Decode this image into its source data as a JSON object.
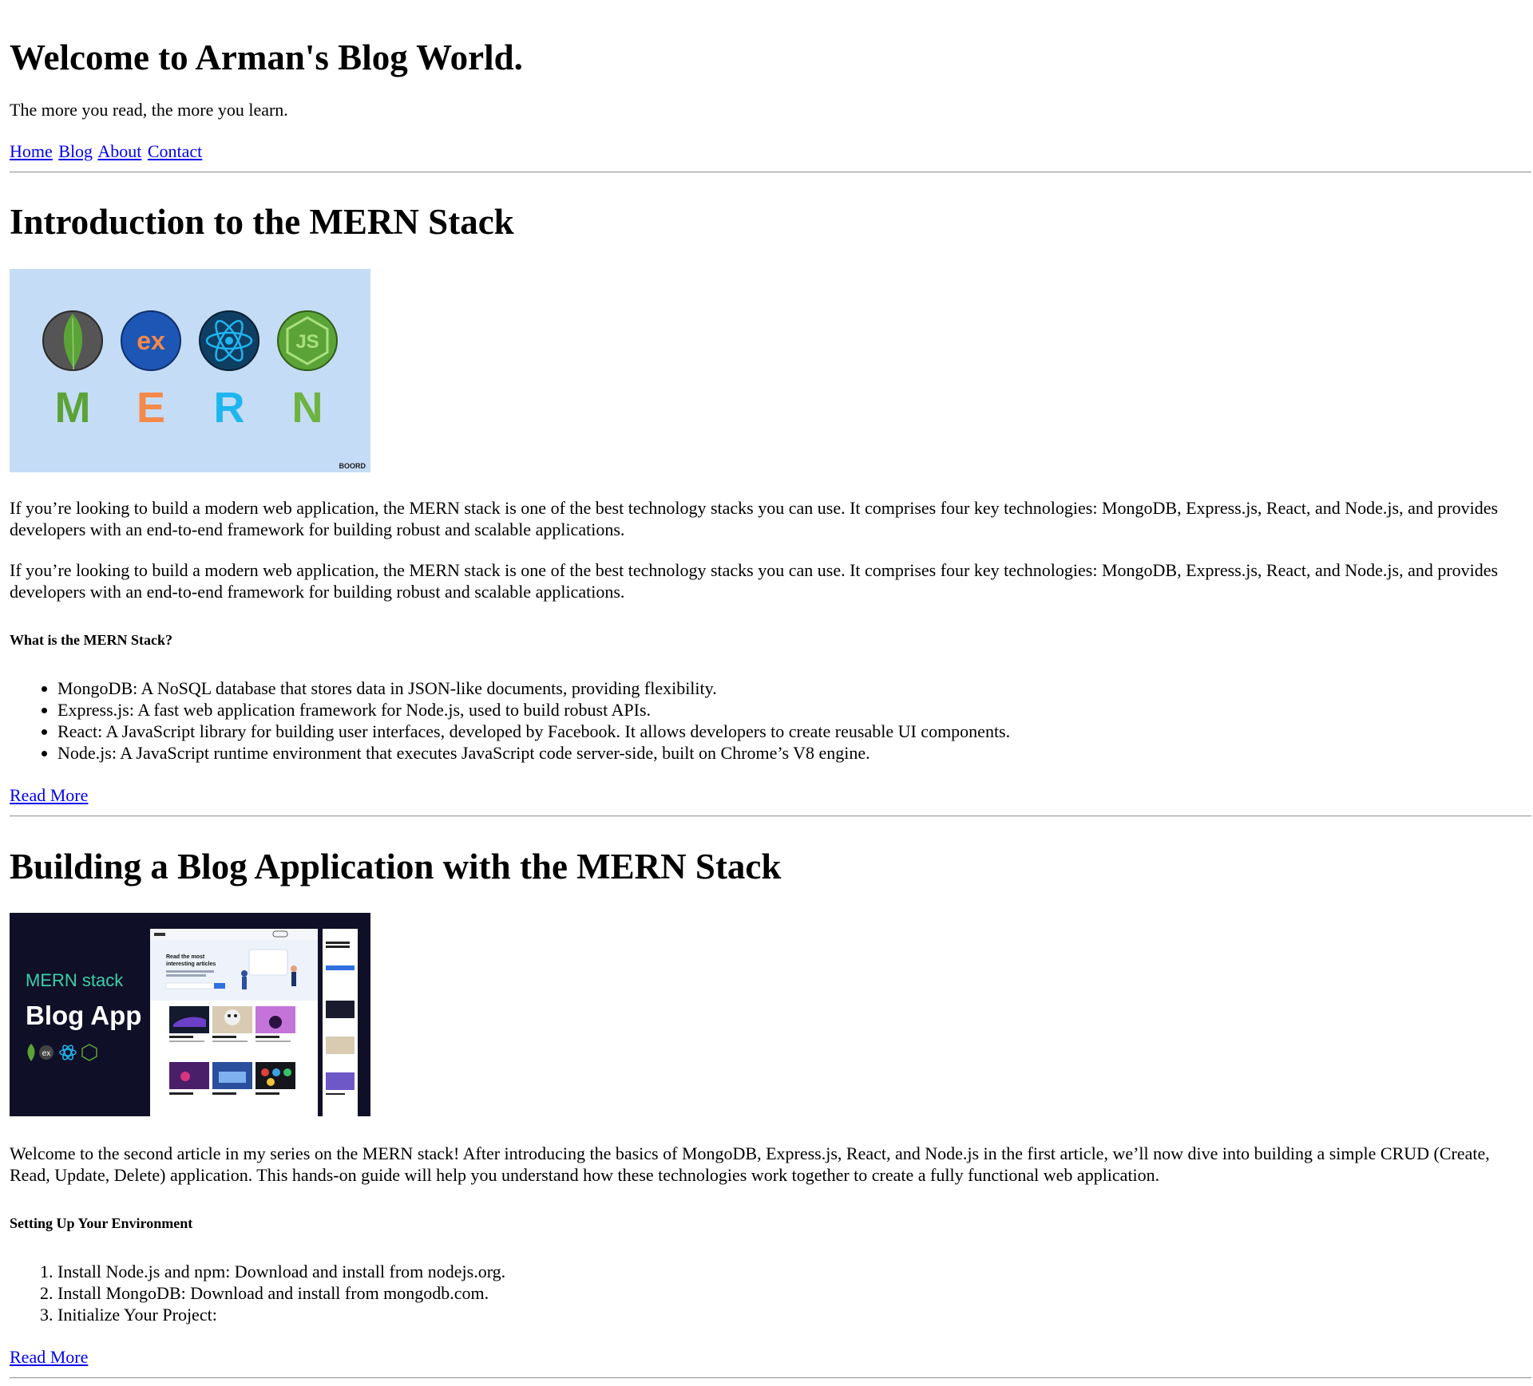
{
  "header": {
    "title": "Welcome to Arman's Blog World.",
    "tagline": "The more you read, the more you learn."
  },
  "nav": {
    "items": [
      {
        "label": "Home"
      },
      {
        "label": "Blog"
      },
      {
        "label": "About"
      },
      {
        "label": "Contact"
      }
    ]
  },
  "posts": [
    {
      "title": "Introduction to the MERN Stack",
      "image": {
        "icons": [
          "mongodb-icon",
          "express-icon",
          "react-icon",
          "nodejs-icon"
        ],
        "letters": [
          "M",
          "E",
          "R",
          "N"
        ],
        "icon_texts": [
          "ex",
          "JS"
        ],
        "watermark": "BOORD",
        "colors": {
          "background": "#c5dcf6",
          "m": "#5ba337",
          "e": "#f5894a",
          "r": "#1fb6f0",
          "n": "#6cb33f"
        }
      },
      "paragraphs": [
        "If you’re looking to build a modern web application, the MERN stack is one of the best technology stacks you can use. It comprises four key technologies: MongoDB, Express.js, React, and Node.js, and provides developers with an end-to-end framework for building robust and scalable applications.",
        "If you’re looking to build a modern web application, the MERN stack is one of the best technology stacks you can use. It comprises four key technologies: MongoDB, Express.js, React, and Node.js, and provides developers with an end-to-end framework for building robust and scalable applications."
      ],
      "subheading": "What is the MERN Stack?",
      "list": [
        "MongoDB: A NoSQL database that stores data in JSON-like documents, providing flexibility.",
        "Express.js: A fast web application framework for Node.js, used to build robust APIs.",
        "React: A JavaScript library for building user interfaces, developed by Facebook. It allows developers to create reusable UI components.",
        "Node.js: A JavaScript runtime environment that executes JavaScript code server-side, built on Chrome’s V8 engine."
      ],
      "read_more": "Read More"
    },
    {
      "title": "Building a Blog Application with the MERN Stack",
      "image": {
        "line1": "MERN stack",
        "line2": "Blog App",
        "mockup_heading": "Read the most interesting articles",
        "colors": {
          "background": "#0f0f27",
          "accent": "#3ecfa8"
        }
      },
      "paragraphs": [
        "Welcome to the second article in my series on the MERN stack! After introducing the basics of MongoDB, Express.js, React, and Node.js in the first article, we’ll now dive into building a simple CRUD (Create, Read, Update, Delete) application. This hands-on guide will help you understand how these technologies work together to create a fully functional web application."
      ],
      "subheading": "Setting Up Your Environment",
      "list": [
        "Install Node.js and npm: Download and install from nodejs.org.",
        "Install MongoDB: Download and install from mongodb.com.",
        "Initialize Your Project:"
      ],
      "read_more": "Read More"
    }
  ]
}
